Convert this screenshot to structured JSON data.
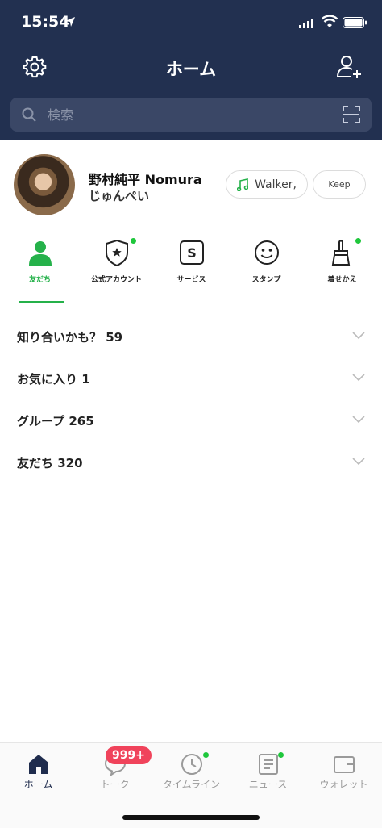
{
  "status_bar": {
    "time": "15:54"
  },
  "header": {
    "title": "ホーム"
  },
  "search": {
    "placeholder": "検索"
  },
  "profile": {
    "name": "野村純平 Nomura",
    "subtitle": "じゅんぺい",
    "music_label": "Walker,",
    "keep_label": "Keep"
  },
  "services": [
    {
      "label": "友だち",
      "icon": "friends-person-icon",
      "active": true
    },
    {
      "label": "公式アカウント",
      "icon": "official-account-shield-icon",
      "notification": true
    },
    {
      "label": "サービス",
      "icon": "services-s-icon"
    },
    {
      "label": "スタンプ",
      "icon": "sticker-smiley-icon"
    },
    {
      "label": "着せかえ",
      "icon": "theme-brush-icon",
      "notification": true
    }
  ],
  "friend_sections": [
    {
      "label": "知り合いかも？ 59"
    },
    {
      "label": "お気に入り 1"
    },
    {
      "label": "グループ 265"
    },
    {
      "label": "友だち 320"
    }
  ],
  "bottom_nav": [
    {
      "label": "ホーム",
      "icon": "home-icon",
      "active": true
    },
    {
      "label": "トーク",
      "icon": "chat-bubble-icon",
      "badge": "999+"
    },
    {
      "label": "タイムライン",
      "icon": "clock-icon",
      "notification": true
    },
    {
      "label": "ニュース",
      "icon": "news-icon",
      "notification": true
    },
    {
      "label": "ウォレット",
      "icon": "wallet-icon"
    }
  ],
  "colors": {
    "header_bg": "#223050",
    "accent_green": "#25b14a",
    "notification_dot": "#1fc73c",
    "badge_red": "#f0435b"
  }
}
